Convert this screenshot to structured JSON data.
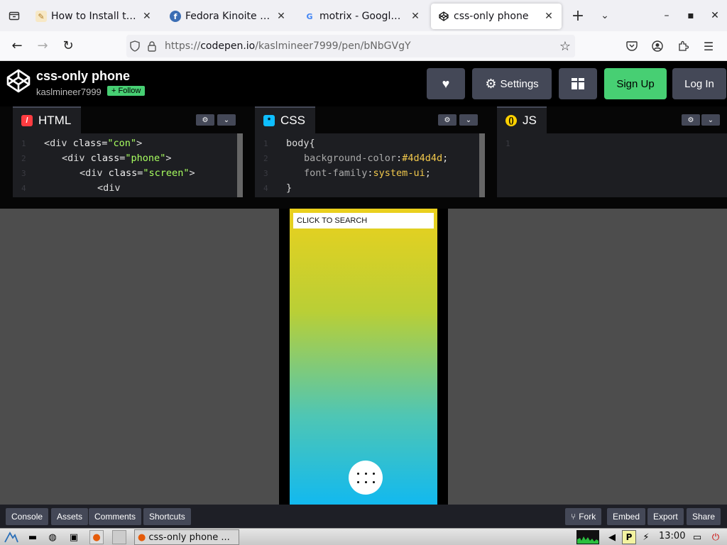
{
  "browser": {
    "tabs": [
      {
        "title": "How to Install the L",
        "favicon": "blog-favicon",
        "active": false
      },
      {
        "title": "Fedora Kinoite | The",
        "favicon": "fedora-favicon",
        "active": false
      },
      {
        "title": "motrix - Google Sea",
        "favicon": "google-favicon",
        "active": false
      },
      {
        "title": "css-only phone",
        "favicon": "codepen-favicon",
        "active": true
      }
    ],
    "url_prefix": "https://",
    "url_domain": "codepen.io",
    "url_path": "/kaslmineer7999/pen/bNbGVgY"
  },
  "codepen": {
    "pen_title": "css-only phone",
    "username": "kaslmineer7999",
    "follow_label": "+ Follow",
    "settings_label": "Settings",
    "signup_label": "Sign Up",
    "login_label": "Log In"
  },
  "editors": {
    "html": {
      "label": "HTML",
      "lines": [
        {
          "n": "1",
          "parts": [
            [
              "tag",
              "<div "
            ],
            [
              "attr",
              "class="
            ],
            [
              "val",
              "\"con\""
            ],
            [
              "tag",
              ">"
            ]
          ],
          "indent": 0
        },
        {
          "n": "2",
          "parts": [
            [
              "tag",
              "<div "
            ],
            [
              "attr",
              "class="
            ],
            [
              "val",
              "\"phone\""
            ],
            [
              "tag",
              ">"
            ]
          ],
          "indent": 1
        },
        {
          "n": "3",
          "parts": [
            [
              "tag",
              "<div "
            ],
            [
              "attr",
              "class="
            ],
            [
              "val",
              "\"screen\""
            ],
            [
              "tag",
              ">"
            ]
          ],
          "indent": 2
        },
        {
          "n": "4",
          "parts": [
            [
              "tag",
              "<div"
            ]
          ],
          "indent": 3
        }
      ]
    },
    "css": {
      "label": "CSS",
      "lines": [
        {
          "n": "1",
          "parts": [
            [
              "sel",
              "body{"
            ]
          ],
          "indent": 0
        },
        {
          "n": "2",
          "parts": [
            [
              "prop",
              "background-color"
            ],
            [
              "sel",
              ":"
            ],
            [
              "cval",
              "#4d4d4d"
            ],
            [
              "sel",
              ";"
            ]
          ],
          "indent": 1
        },
        {
          "n": "3",
          "parts": [
            [
              "prop",
              "font-family"
            ],
            [
              "sel",
              ":"
            ],
            [
              "cval",
              "system-ui"
            ],
            [
              "sel",
              ";"
            ]
          ],
          "indent": 1
        },
        {
          "n": "4",
          "parts": [
            [
              "sel",
              "}"
            ]
          ],
          "indent": 0
        }
      ]
    },
    "js": {
      "label": "JS",
      "lines": [
        {
          "n": "1",
          "parts": [],
          "indent": 0
        }
      ]
    }
  },
  "preview": {
    "search_label": "CLICK TO SEARCH",
    "background": "#4d4d4d"
  },
  "footer": {
    "console": "Console",
    "assets": "Assets",
    "comments": "Comments",
    "shortcuts": "Shortcuts",
    "fork": "Fork",
    "embed": "Embed",
    "export": "Export",
    "share": "Share"
  },
  "taskbar": {
    "task_title": "css-only phone ...",
    "clock": "13:00"
  },
  "colors": {
    "accent_green": "#47cf73",
    "html_icon": "#ff3c41",
    "css_icon": "#0ebeff",
    "js_icon": "#fcd000"
  }
}
